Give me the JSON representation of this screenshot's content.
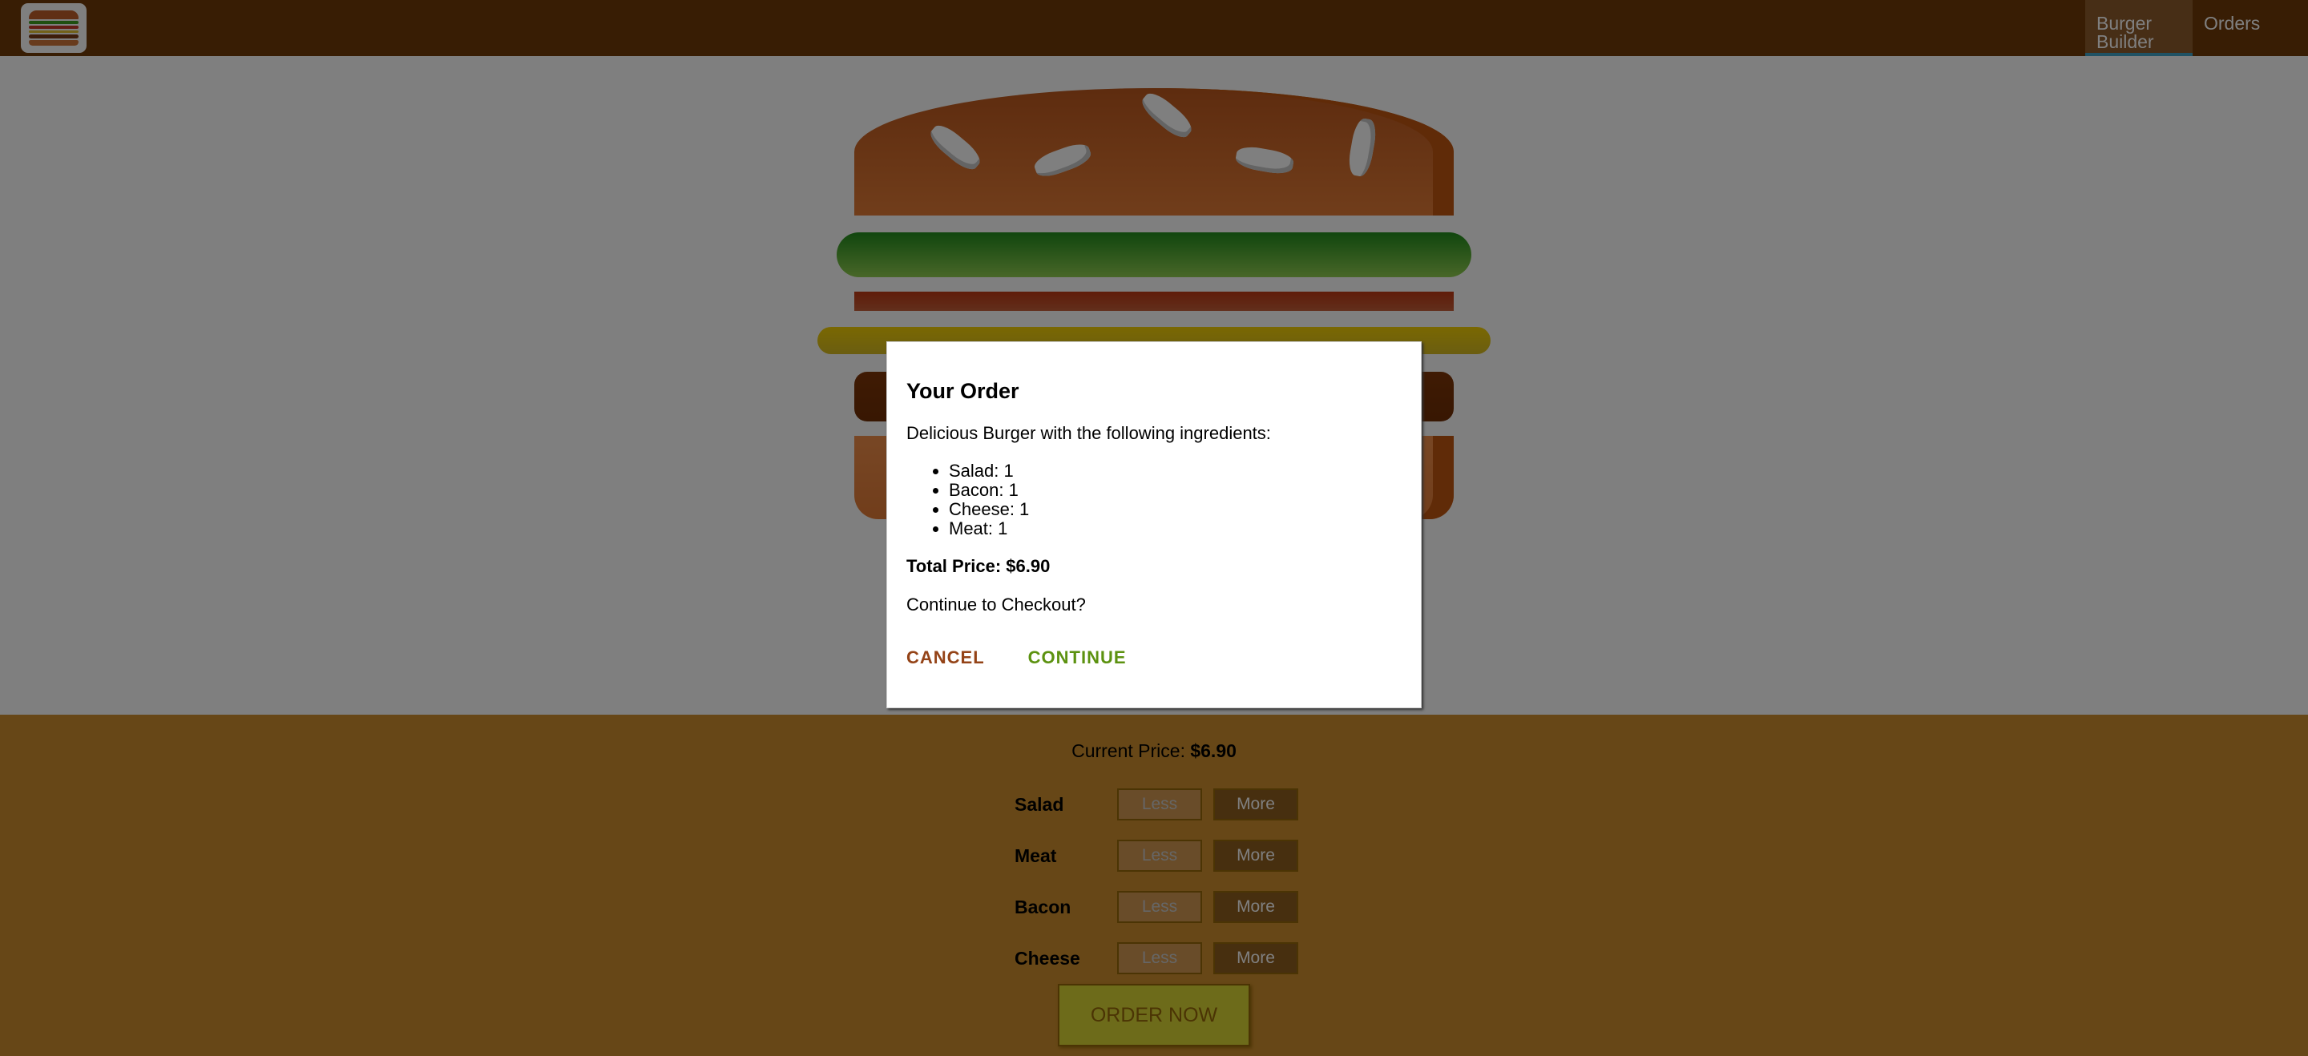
{
  "toolbar": {
    "logo_icon": "burger-logo-icon",
    "nav": [
      {
        "label": "Burger Builder",
        "active": true
      },
      {
        "label": "Orders",
        "active": false
      }
    ],
    "colors": {
      "background": "#703b09",
      "active_tab": "#8f5c2c",
      "active_underline": "#40a4c8"
    }
  },
  "burger": {
    "layers": [
      "bread-top",
      "salad",
      "bacon",
      "cheese",
      "meat",
      "bread-bottom"
    ]
  },
  "controls": {
    "price_label": "Current Price:",
    "price_value": "$6.90",
    "rows": [
      {
        "label": "Salad",
        "less": "Less",
        "more": "More"
      },
      {
        "label": "Meat",
        "less": "Less",
        "more": "More"
      },
      {
        "label": "Bacon",
        "less": "Less",
        "more": "More"
      },
      {
        "label": "Cheese",
        "less": "Less",
        "more": "More"
      }
    ],
    "order_button": "ORDER NOW",
    "colors": {
      "background": "#cf8f2e",
      "order": "#dad735"
    }
  },
  "modal": {
    "title": "Your Order",
    "intro": "Delicious Burger with the following ingredients:",
    "items": [
      "Salad: 1",
      "Bacon: 1",
      "Cheese: 1",
      "Meat: 1"
    ],
    "total": "Total Price: $6.90",
    "question": "Continue to Checkout?",
    "cancel": "CANCEL",
    "continue": "CONTINUE",
    "colors": {
      "cancel": "#944317",
      "continue": "#5c9210"
    }
  }
}
